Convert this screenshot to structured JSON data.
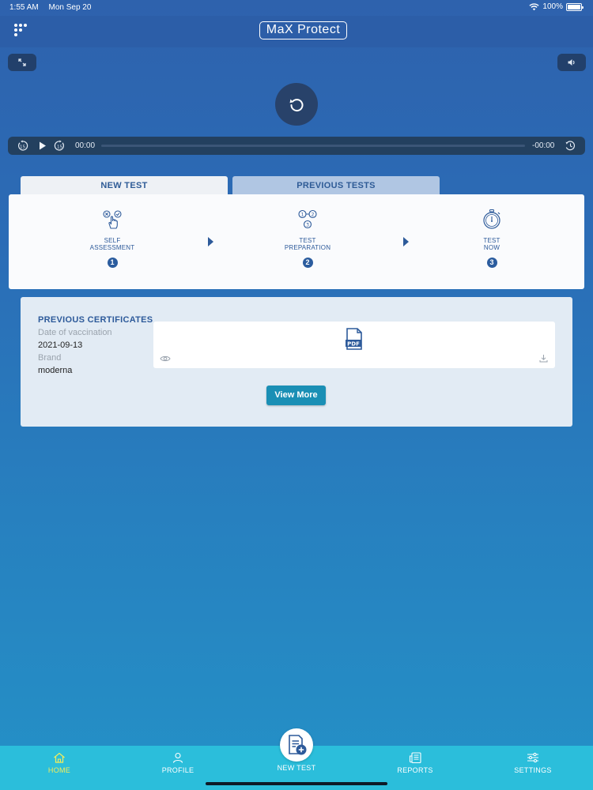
{
  "status_bar": {
    "time": "1:55 AM",
    "date": "Mon Sep 20",
    "battery": "100%"
  },
  "header": {
    "title": "MaX Protect"
  },
  "player": {
    "time_elapsed": "00:00",
    "time_remaining": "-00:00",
    "skip_back_seconds": "15",
    "skip_forward_seconds": "15"
  },
  "tabs": {
    "new_test": "NEW TEST",
    "previous_tests": "PREVIOUS TESTS"
  },
  "steps": [
    {
      "line1": "SELF",
      "line2": "ASSESSMENT",
      "number": "1",
      "icon": "hand-touch-icon"
    },
    {
      "line1": "TEST",
      "line2": "PREPARATION",
      "number": "2",
      "icon": "numbered-steps-icon"
    },
    {
      "line1": "TEST",
      "line2": "NOW",
      "number": "3",
      "icon": "stopwatch-icon"
    }
  ],
  "certificates": {
    "title": "PREVIOUS CERTIFICATES",
    "date_label": "Date of vaccination",
    "date_value": "2021-09-13",
    "brand_label": "Brand",
    "brand_value": "moderna",
    "file_icon_text": "PDF",
    "view_more": "View More"
  },
  "bottom_nav": {
    "home": "HOME",
    "profile": "PROFILE",
    "new_test": "NEW TEST",
    "reports": "REPORTS",
    "settings": "SETTINGS",
    "active": "home"
  },
  "colors": {
    "accent": "#2d5a9a",
    "nav_bg": "#2bbedb",
    "active_nav": "#f4ee5a",
    "button": "#1a8fb5"
  }
}
